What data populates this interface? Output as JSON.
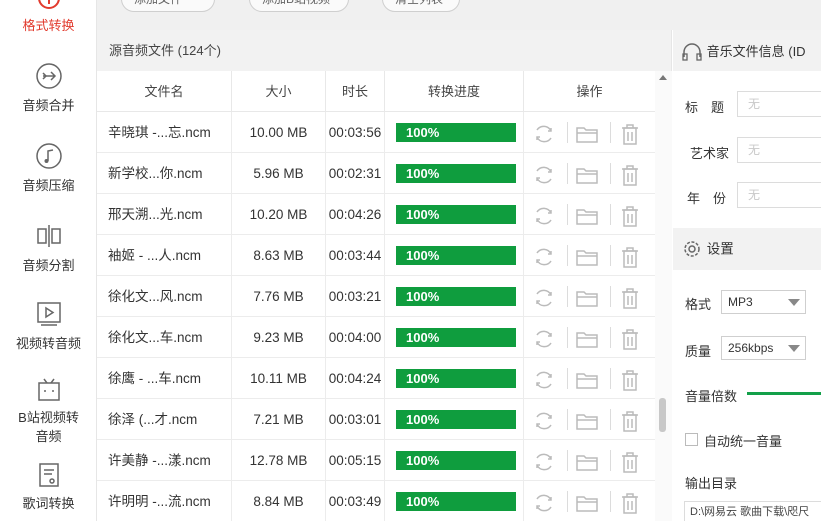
{
  "toolbar": {
    "add_file_label": "添加文件",
    "add_folder_label": "添加B站视频",
    "clear_list_label": "清空列表"
  },
  "nav": {
    "items": [
      {
        "label": "格式转换",
        "icon": "clock-convert-icon"
      },
      {
        "label": "音频合并",
        "icon": "merge-arrow-icon"
      },
      {
        "label": "音频压缩",
        "icon": "music-note-icon"
      },
      {
        "label": "音频分割",
        "icon": "split-icon"
      },
      {
        "label": "视频转音频",
        "icon": "video-play-icon"
      },
      {
        "label": "B站视频转",
        "label2": "音频",
        "icon": "tv-icon"
      },
      {
        "label": "歌词转换",
        "icon": "lyrics-icon"
      }
    ]
  },
  "file_panel": {
    "title": "源音频文件 (124个)",
    "columns": [
      "文件名",
      "大小",
      "时长",
      "转换进度",
      "操作"
    ],
    "rows": [
      {
        "name": "辛晓琪 -...忘.ncm",
        "size": "10.00 MB",
        "duration": "00:03:56",
        "progress": "100%",
        "progress_value": 1.0
      },
      {
        "name": "新学校...你.ncm",
        "size": "5.96 MB",
        "duration": "00:02:31",
        "progress": "100%",
        "progress_value": 1.0
      },
      {
        "name": "邢天溯...光.ncm",
        "size": "10.20 MB",
        "duration": "00:04:26",
        "progress": "100%",
        "progress_value": 1.0
      },
      {
        "name": "袖姬 - ...人.ncm",
        "size": "8.63 MB",
        "duration": "00:03:44",
        "progress": "100%",
        "progress_value": 1.0
      },
      {
        "name": "徐化文...风.ncm",
        "size": "7.76 MB",
        "duration": "00:03:21",
        "progress": "100%",
        "progress_value": 1.0
      },
      {
        "name": "徐化文...车.ncm",
        "size": "9.23 MB",
        "duration": "00:04:00",
        "progress": "100%",
        "progress_value": 1.0
      },
      {
        "name": "徐鹰 - ...车.ncm",
        "size": "10.11 MB",
        "duration": "00:04:24",
        "progress": "100%",
        "progress_value": 1.0
      },
      {
        "name": "徐泽 (...才.ncm",
        "size": "7.21 MB",
        "duration": "00:03:01",
        "progress": "100%",
        "progress_value": 1.0
      },
      {
        "name": "许美静 -...漾.ncm",
        "size": "12.78 MB",
        "duration": "00:05:15",
        "progress": "100%",
        "progress_value": 1.0
      },
      {
        "name": "许明明 -...流.ncm",
        "size": "8.84 MB",
        "duration": "00:03:49",
        "progress": "100%",
        "progress_value": 1.0
      }
    ]
  },
  "info_panel": {
    "title": "音乐文件信息 (ID",
    "fields": [
      {
        "label": "标　题",
        "placeholder": "无"
      },
      {
        "label": "艺术家",
        "placeholder": "无"
      },
      {
        "label": "年　份",
        "placeholder": "无"
      }
    ]
  },
  "settings": {
    "title": "设置",
    "format_label": "格式",
    "format_value": "MP3",
    "quality_label": "质量",
    "quality_value": "256kbps",
    "volume_label": "音量倍数",
    "auto_volume_label": "自动统一音量",
    "output_label": "输出目录",
    "output_path": "D:\\网易云 歌曲下载\\咫尺"
  },
  "colors": {
    "accent_red": "#e23b2e",
    "progress_green": "#0f9d3e"
  }
}
